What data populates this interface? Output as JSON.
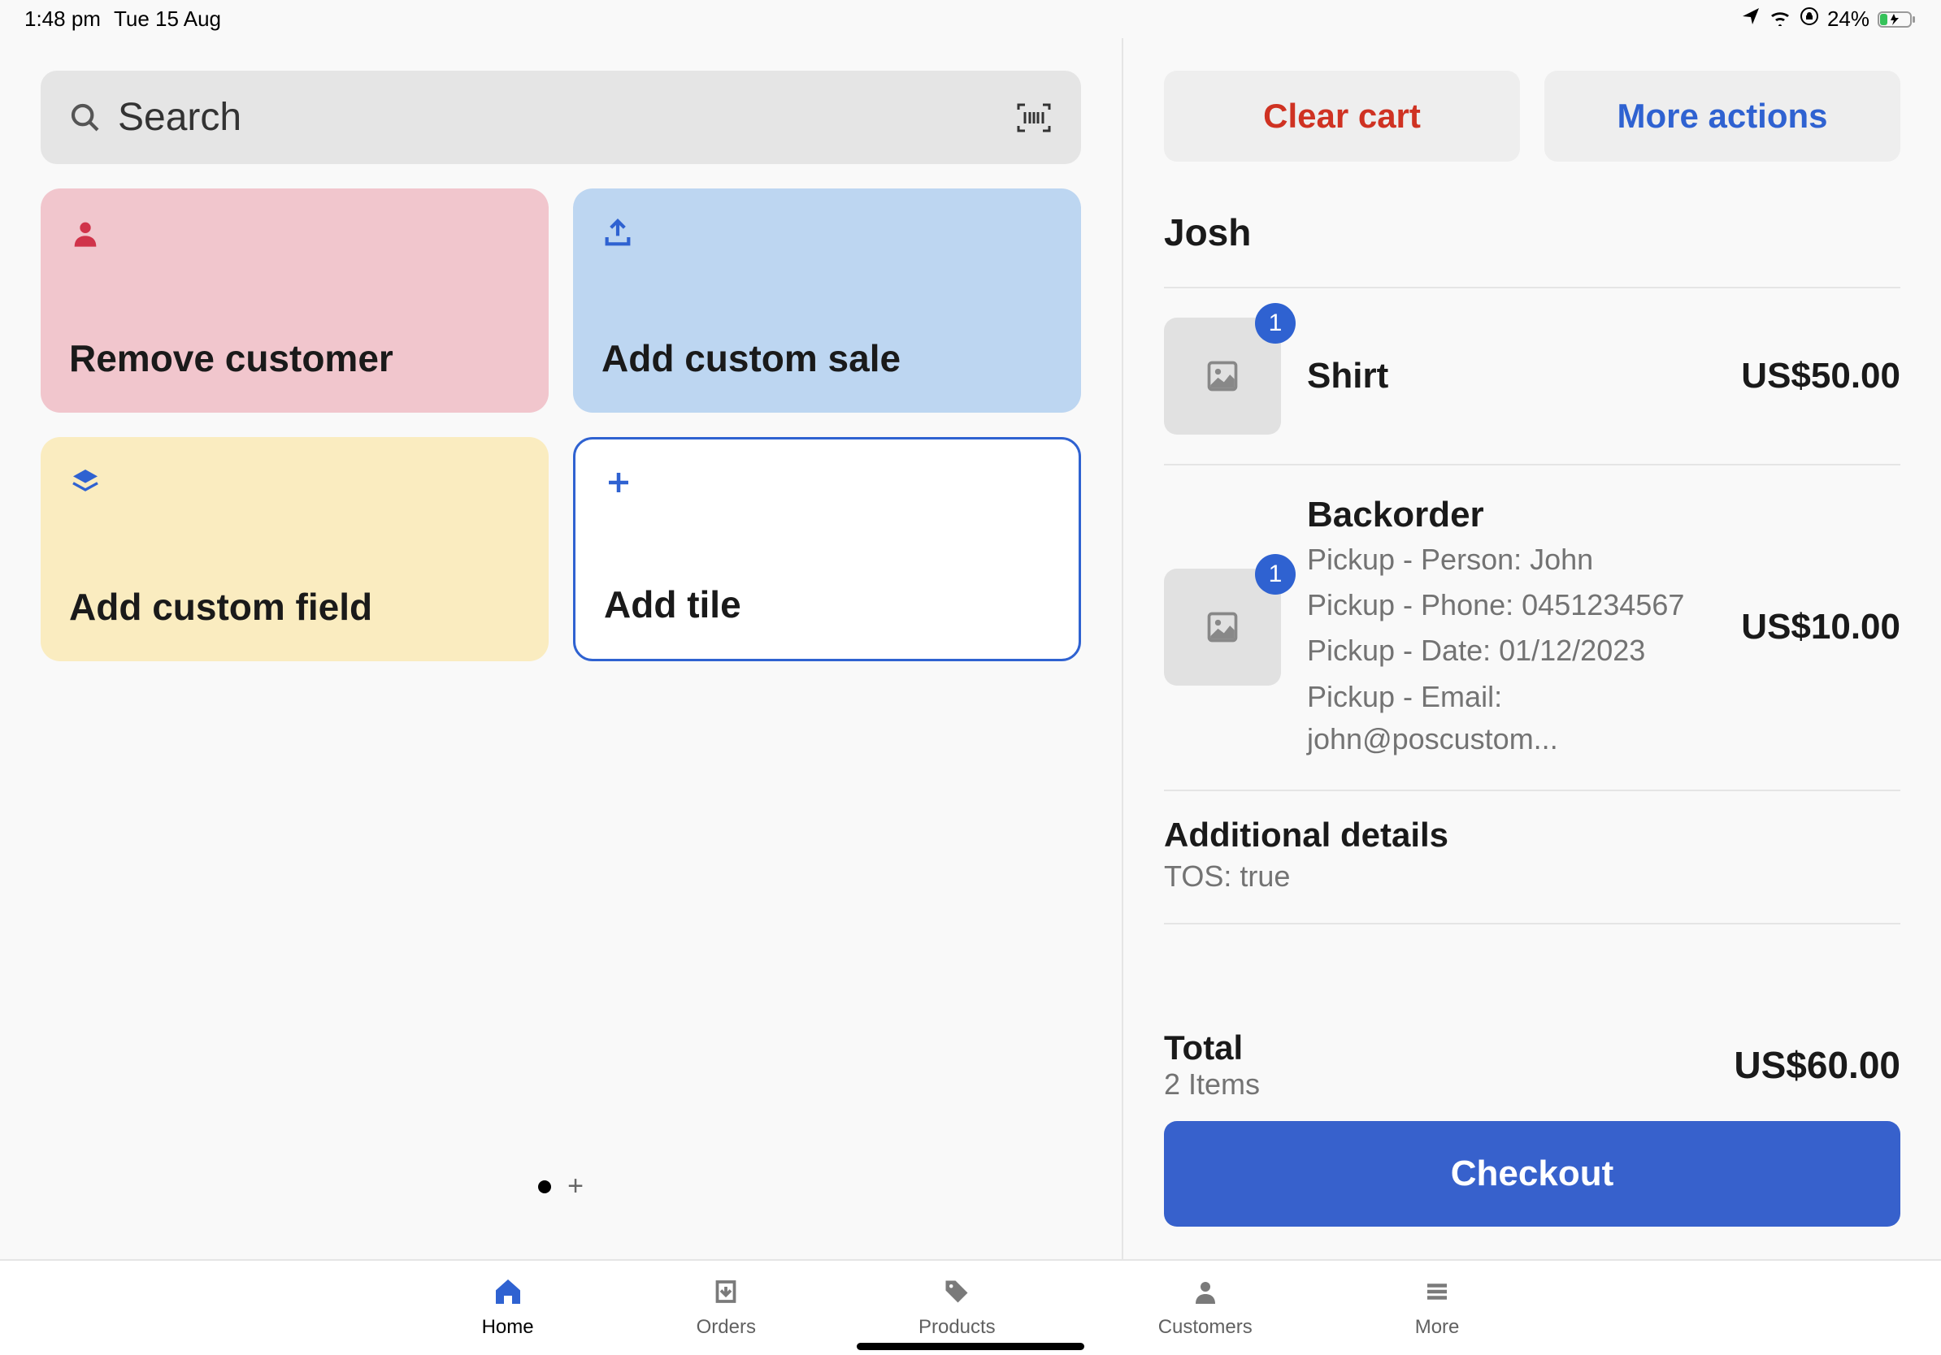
{
  "status": {
    "time": "1:48 pm",
    "date": "Tue 15 Aug",
    "battery": "24%"
  },
  "search": {
    "placeholder": "Search"
  },
  "tiles": {
    "remove_customer": "Remove customer",
    "add_custom_sale": "Add custom sale",
    "add_custom_field": "Add custom field",
    "add_tile": "Add tile"
  },
  "cart_actions": {
    "clear": "Clear cart",
    "more": "More actions"
  },
  "customer": "Josh",
  "items": [
    {
      "qty": "1",
      "title": "Shirt",
      "price": "US$50.00",
      "meta": []
    },
    {
      "qty": "1",
      "title": "Backorder",
      "price": "US$10.00",
      "meta": [
        "Pickup - Person: John",
        "Pickup - Phone: 0451234567",
        "Pickup - Date: 01/12/2023",
        "Pickup - Email: john@poscustom..."
      ]
    }
  ],
  "additional": {
    "title": "Additional details",
    "text": "TOS: true"
  },
  "total": {
    "label": "Total",
    "items": "2 Items",
    "amount": "US$60.00"
  },
  "checkout": "Checkout",
  "nav": {
    "home": "Home",
    "orders": "Orders",
    "products": "Products",
    "customers": "Customers",
    "more": "More"
  }
}
